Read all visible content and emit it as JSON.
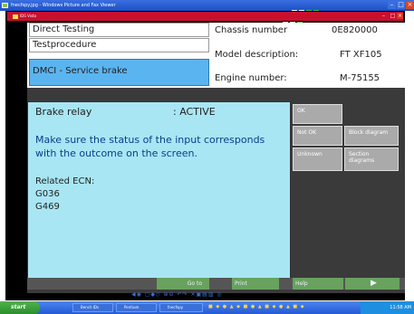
{
  "window": {
    "title": "fnecfspy.jpg - Windows Picture and Fax Viewer"
  },
  "inner_window": {
    "title": "IDS Vista"
  },
  "header": {
    "rows": [
      "Direct Testing",
      "Testprocedure",
      "DMCI - Service brake"
    ],
    "fields": [
      {
        "label": "Chassis number",
        "value": "0E820000"
      },
      {
        "label": "Model description:",
        "value": "FT XF105"
      },
      {
        "label": "Engine number:",
        "value": "M-75155"
      }
    ]
  },
  "panel": {
    "relay_label": "Brake relay",
    "relay_sep": ":",
    "relay_value": "ACTIVE",
    "message": "Make sure the status of the input corresponds with the outcome on the screen.",
    "ecn_label": "Related ECN:",
    "ecn_items": [
      "G036",
      "G469"
    ]
  },
  "side_buttons": [
    "OK",
    "Not OK",
    "Block diagram",
    "Unknown",
    "Section diagrams"
  ],
  "footer": {
    "goto": "Go to",
    "print": "Print",
    "help": "Help"
  },
  "taskbar": {
    "start": "start",
    "tasks": [
      "Bench IDs",
      "Pentium",
      "fnecfspy"
    ],
    "clock": "11:58 AM"
  },
  "colors": {
    "panel": "#a8e6f4",
    "selected_row": "#5ab4f0",
    "title_bar": "#245ad6",
    "inner_title": "#c8102e"
  }
}
